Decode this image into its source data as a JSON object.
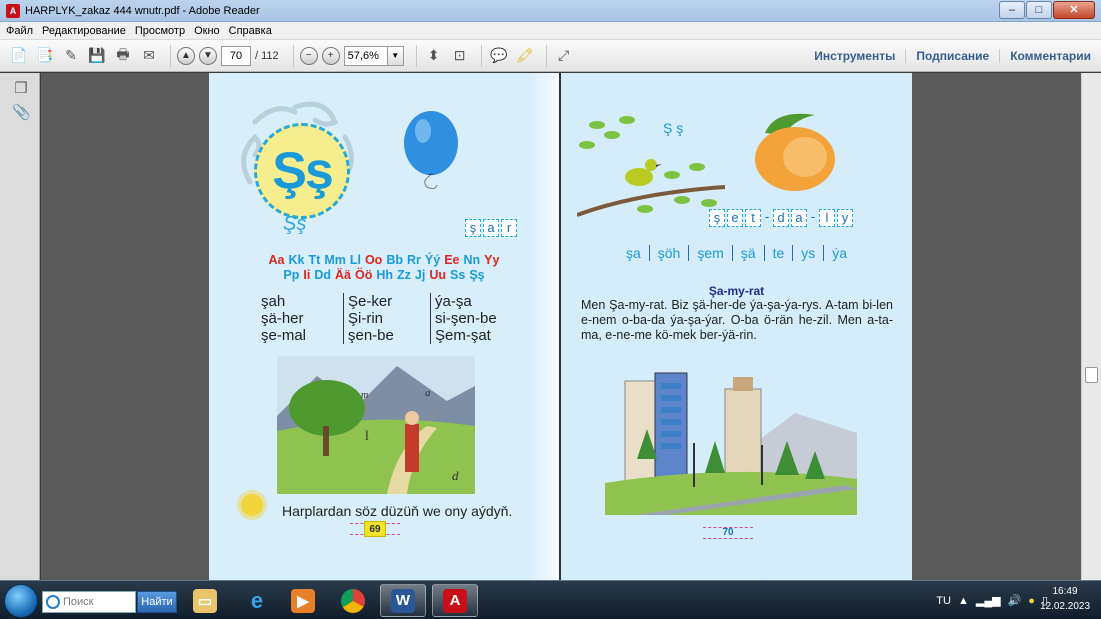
{
  "window": {
    "title": "HARPLYK_zakaz 444 wnutr.pdf - Adobe Reader",
    "minimize": "–",
    "maximize": "□",
    "close": "✕"
  },
  "menu": [
    "Файл",
    "Редактирование",
    "Просмотр",
    "Окно",
    "Справка"
  ],
  "toolbar": {
    "page_current": "70",
    "page_total": "/ 112",
    "zoom": "57,6%",
    "right_buttons": [
      "Инструменты",
      "Подписание",
      "Комментарии"
    ]
  },
  "left_page": {
    "big_letter": "Şş",
    "handwritten_letter": "Şş",
    "word_letters": [
      "ş",
      "a",
      "r"
    ],
    "alphabet_line1": [
      {
        "t": "Aa",
        "c": "red"
      },
      {
        "t": "Kk",
        "c": "blue"
      },
      {
        "t": "Tt",
        "c": "blue"
      },
      {
        "t": "Mm",
        "c": "blue"
      },
      {
        "t": "Ll",
        "c": "blue"
      },
      {
        "t": "Oo",
        "c": "red"
      },
      {
        "t": "Bb",
        "c": "blue"
      },
      {
        "t": "Rr",
        "c": "blue"
      },
      {
        "t": "Ýý",
        "c": "blue"
      },
      {
        "t": "Ee",
        "c": "red"
      },
      {
        "t": "Nn",
        "c": "blue"
      },
      {
        "t": "Yy",
        "c": "red"
      }
    ],
    "alphabet_line2": [
      {
        "t": "Pp",
        "c": "blue"
      },
      {
        "t": "Ii",
        "c": "red"
      },
      {
        "t": "Dd",
        "c": "blue"
      },
      {
        "t": "Ää",
        "c": "red"
      },
      {
        "t": "Öö",
        "c": "red"
      },
      {
        "t": "Hh",
        "c": "blue"
      },
      {
        "t": "Zz",
        "c": "blue"
      },
      {
        "t": "Jj",
        "c": "blue"
      },
      {
        "t": "Uu",
        "c": "red"
      },
      {
        "t": "Ss",
        "c": "blue"
      },
      {
        "t": "Şş",
        "c": "blue"
      }
    ],
    "syllables": [
      [
        "şah",
        "şä-her",
        "şe-mal"
      ],
      [
        "Şe-ker",
        "Şi-rin",
        "şen-be"
      ],
      [
        "ýa-şa",
        "si-şen-be",
        "Şem-şat"
      ]
    ],
    "illustration_letters": [
      "m",
      "l",
      "a",
      "d"
    ],
    "footnote": "Harplardan söz düzüň we ony aýdyň.",
    "page_number": "69"
  },
  "right_page": {
    "bird_letters": "Ş ş",
    "word_letters": [
      "ş",
      "e",
      "t",
      "-",
      "d",
      "a",
      "-",
      "l",
      "y"
    ],
    "syllables": [
      "şa",
      "şöh",
      "şem",
      "şä",
      "te",
      "ys",
      "ýa"
    ],
    "story_title": "Şa-my-rat",
    "story": "Men Şa-my-rat. Biz şä-her-de ýa-şa-ýa-rys. A-tam bi-len e-nem o-ba-da ýa-şa-ýar. O-ba ö-rän he-zil. Men a-ta-ma, e-ne-me kö-mek ber-ýä-rin.",
    "page_number": "70"
  },
  "taskbar": {
    "search_placeholder": "Поиск",
    "go_button": "Найти",
    "language": "TU",
    "time": "16:49",
    "date": "12.02.2023"
  },
  "colors": {
    "accent_blue": "#1a9ad8",
    "alphabet_red": "#e1261c",
    "title_navy": "#1b2d8c"
  }
}
